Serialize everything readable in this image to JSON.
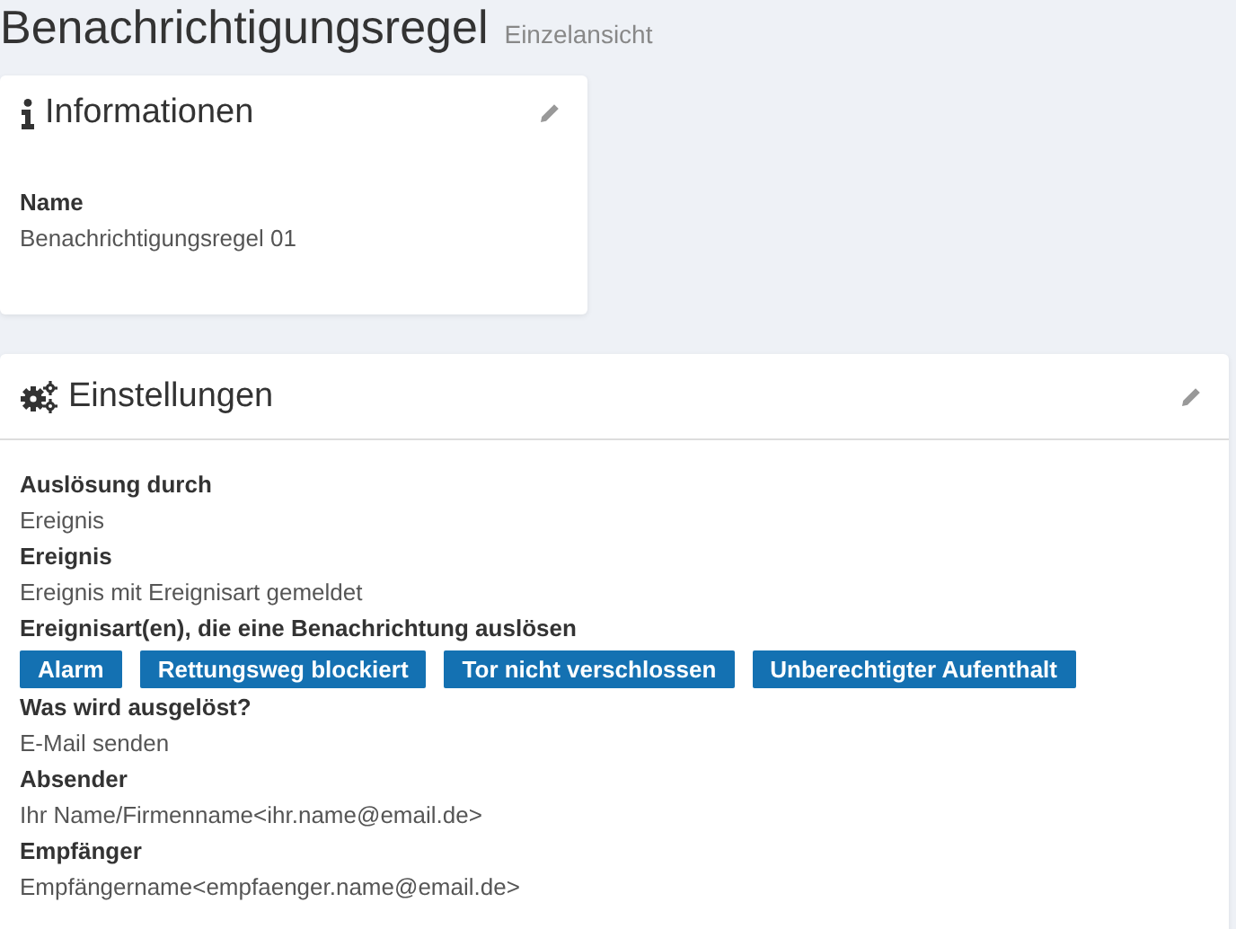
{
  "page": {
    "title": "Benachrichtigungsregel",
    "subtitle": "Einzelansicht"
  },
  "info_card": {
    "title": "Informationen",
    "fields": [
      {
        "label": "Name",
        "value": "Benachrichtigungsregel 01"
      }
    ]
  },
  "settings_card": {
    "title": "Einstellungen",
    "fields": [
      {
        "kind": "text",
        "label": "Auslösung durch",
        "value": "Ereignis"
      },
      {
        "kind": "text",
        "label": "Ereignis",
        "value": "Ereignis mit Ereignisart gemeldet"
      },
      {
        "kind": "tags",
        "label": "Ereignisart(en), die eine Benachrichtung auslösen",
        "tags": [
          "Alarm",
          "Rettungsweg blockiert",
          "Tor nicht verschlossen",
          "Unberechtigter Aufenthalt"
        ]
      },
      {
        "kind": "text",
        "label": "Was wird ausgelöst?",
        "value": "E-Mail senden"
      },
      {
        "kind": "text",
        "label": "Absender",
        "value": "Ihr Name/Firmenname<ihr.name@email.de>"
      },
      {
        "kind": "text",
        "label": "Empfänger",
        "value": "Empfängername<empfaenger.name@email.de>"
      }
    ]
  }
}
